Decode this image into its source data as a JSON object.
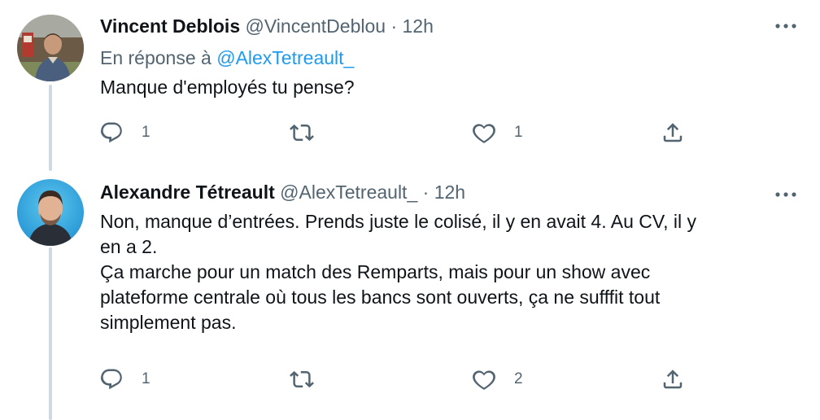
{
  "tweets": [
    {
      "name": "Vincent Deblois",
      "handle": "@VincentDeblou",
      "separator": "·",
      "time": "12h",
      "reply_prefix": "En réponse à",
      "reply_mention": "@AlexTetreault_",
      "text_lines": [
        "Manque d'employés tu pense?"
      ],
      "replies": "1",
      "retweets": "",
      "likes": "1",
      "icons": {
        "reply": "reply-icon",
        "retweet": "retweet-icon",
        "like": "heart-icon",
        "share": "share-icon",
        "more": "more-icon"
      }
    },
    {
      "name": "Alexandre Tétreault",
      "handle": "@AlexTetreault_",
      "separator": "·",
      "time": "12h",
      "text_lines": [
        "Non, manque d’entrées. Prends juste le colisé, il y en avait 4. Au CV, il y",
        "en a 2.",
        "Ça marche pour un match des Remparts, mais pour un show avec",
        "plateforme centrale où tous les bancs sont ouverts, ça ne sufffit tout",
        "simplement pas."
      ],
      "replies": "1",
      "retweets": "",
      "likes": "2",
      "icons": {
        "reply": "reply-icon",
        "retweet": "retweet-icon",
        "like": "heart-icon",
        "share": "share-icon",
        "more": "more-icon"
      }
    }
  ],
  "colors": {
    "text": "#0f1419",
    "secondary": "#536471",
    "link": "#1d9bf0",
    "thread_line": "#cfd9de"
  }
}
